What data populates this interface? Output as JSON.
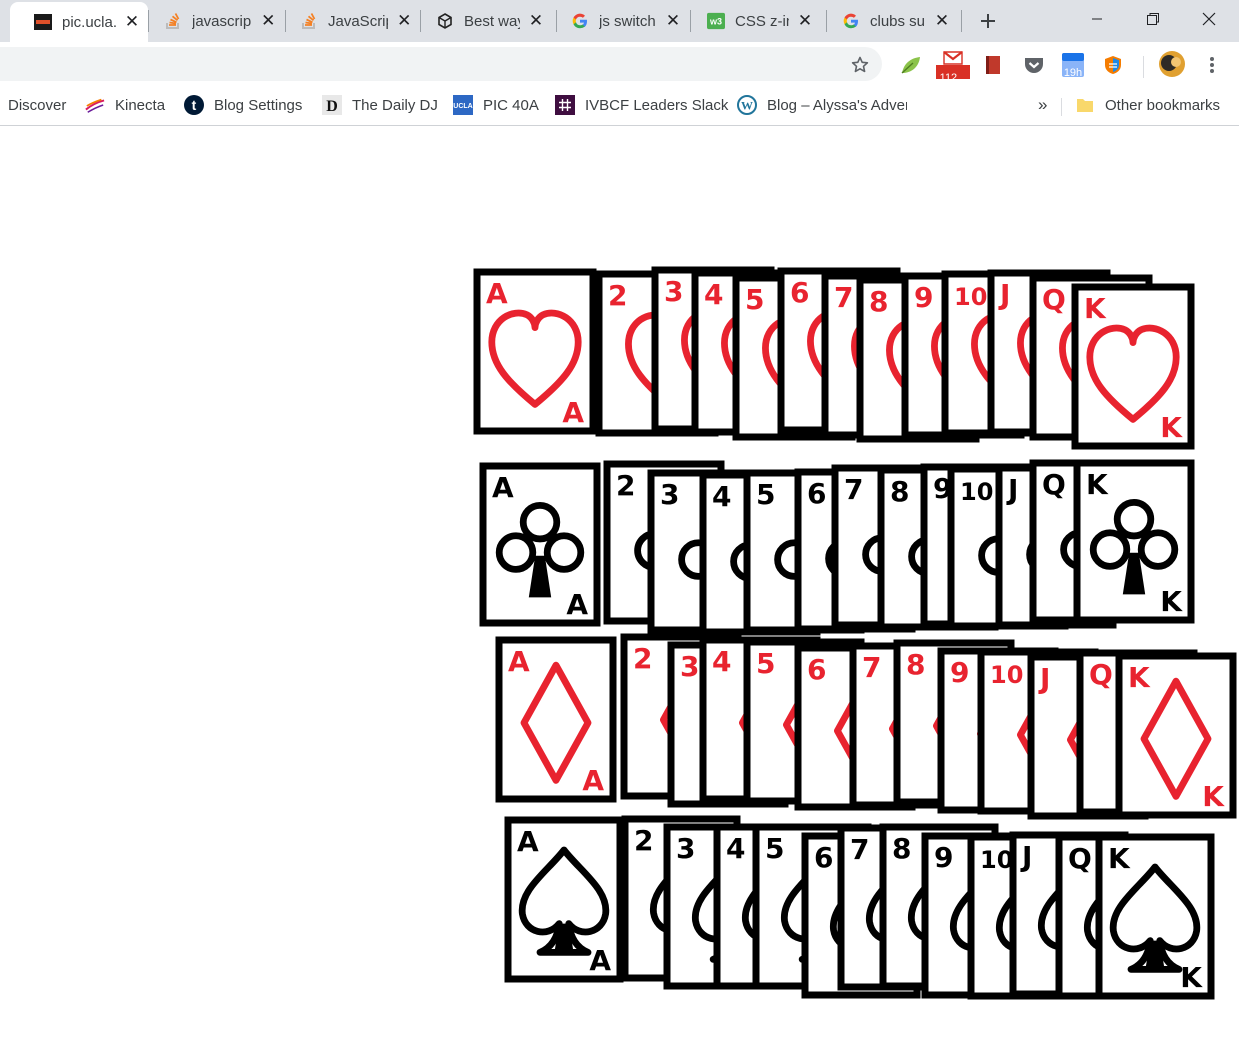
{
  "tabs": [
    {
      "title": "pic.ucla.",
      "icon": "pic-favicon-icon",
      "active": true
    },
    {
      "title": "javascrip",
      "icon": "stackoverflow-icon",
      "active": false
    },
    {
      "title": "JavaScrip",
      "icon": "stackoverflow-icon",
      "active": false
    },
    {
      "title": "Best way",
      "icon": "unity-icon",
      "active": false
    },
    {
      "title": "js switch",
      "icon": "google-icon",
      "active": false
    },
    {
      "title": "CSS z-in",
      "icon": "w3schools-icon",
      "active": false
    },
    {
      "title": "clubs su",
      "icon": "google-icon",
      "active": false
    }
  ],
  "toolbar": {
    "url": "",
    "gmail_badge": "112...",
    "calendar_badge": "19h"
  },
  "bookmarks": [
    {
      "label": "Discover",
      "icon": ""
    },
    {
      "label": "Kinecta",
      "icon": "kinecta-icon"
    },
    {
      "label": "Blog Settings",
      "icon": "tumblr-icon"
    },
    {
      "label": "The Daily DJ",
      "icon": "daily-dj-icon"
    },
    {
      "label": "PIC 40A",
      "icon": "ucla-icon"
    },
    {
      "label": "IVBCF Leaders Slack",
      "icon": "slack-icon"
    },
    {
      "label": "Blog – Alyssa's Adver",
      "icon": "wordpress-icon"
    }
  ],
  "bookmarks_overflow": "»",
  "other_bookmarks": "Other bookmarks",
  "colors": {
    "red_suit": "#e8232f",
    "black_suit": "#000000",
    "tabstrip": "#dee1e6"
  },
  "card_rows": [
    {
      "suit": "hearts",
      "color": "red",
      "ranks": [
        "A",
        "2",
        "3",
        "4",
        "5",
        "6",
        "7",
        "8",
        "9",
        "10",
        "J",
        "Q",
        "K"
      ]
    },
    {
      "suit": "clubs",
      "color": "black",
      "ranks": [
        "A",
        "2",
        "3",
        "4",
        "5",
        "6",
        "7",
        "8",
        "9",
        "10",
        "J",
        "Q",
        "K"
      ]
    },
    {
      "suit": "diamonds",
      "color": "red",
      "ranks": [
        "A",
        "2",
        "3",
        "4",
        "5",
        "6",
        "7",
        "8",
        "9",
        "10",
        "J",
        "Q",
        "K"
      ]
    },
    {
      "suit": "spades",
      "color": "black",
      "ranks": [
        "A",
        "2",
        "3",
        "4",
        "5",
        "6",
        "7",
        "8",
        "9",
        "10",
        "J",
        "Q",
        "K"
      ]
    }
  ]
}
